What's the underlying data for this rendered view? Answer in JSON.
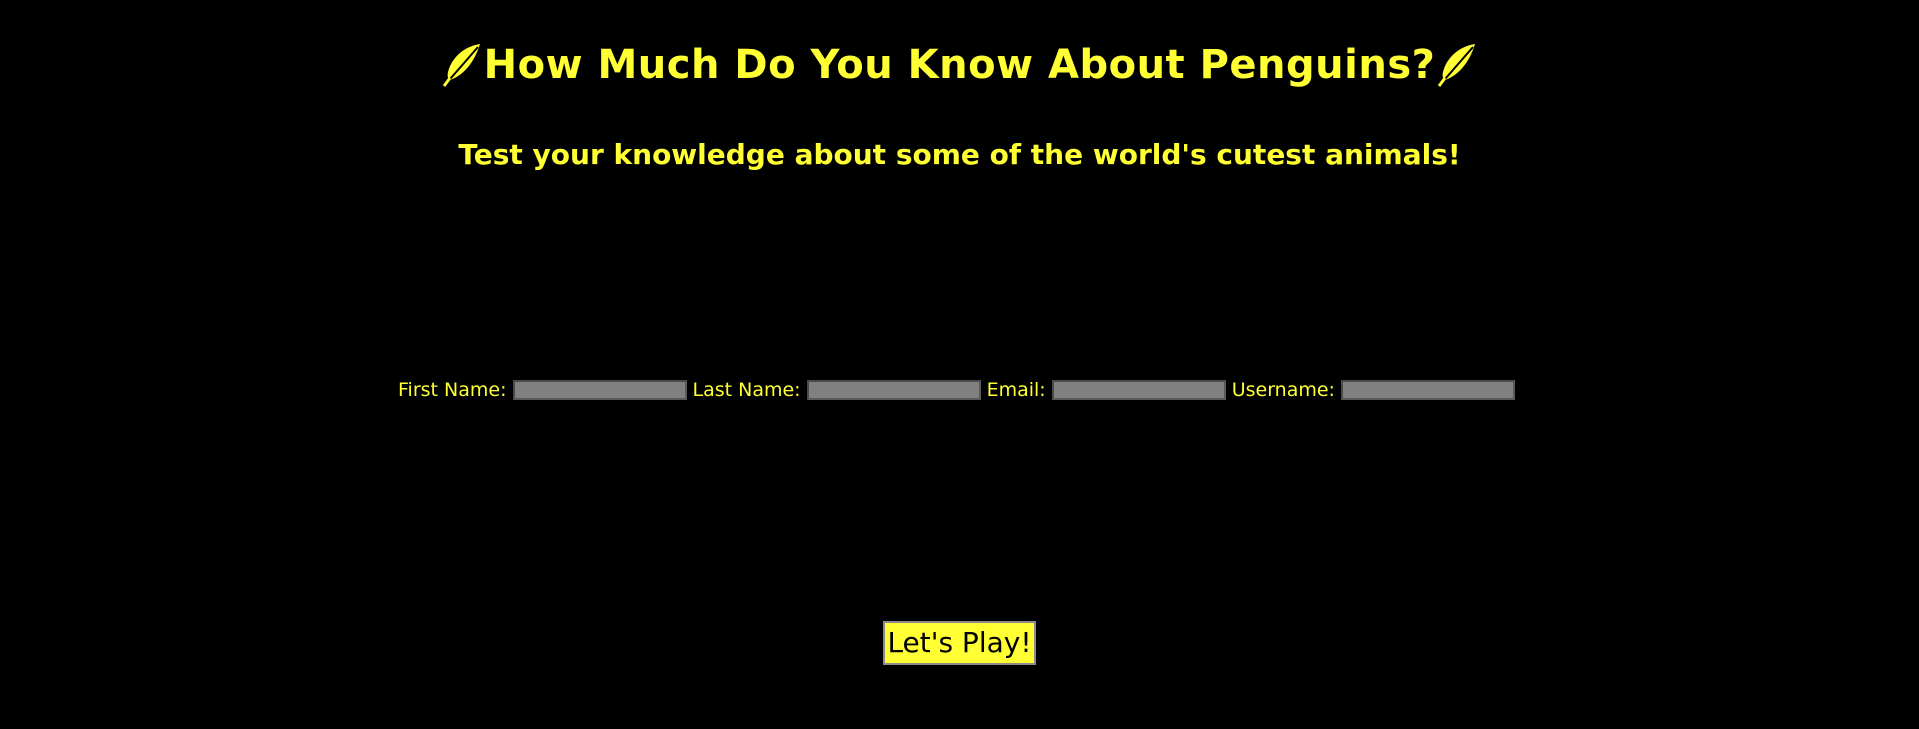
{
  "header": {
    "title": "How Much Do You Know About Penguins?",
    "left_icon": "feather-icon",
    "right_icon": "feather-icon",
    "subtitle": "Test your knowledge about some of the world's cutest animals!"
  },
  "form": {
    "first_name_label": "First Name:",
    "first_name_value": "",
    "last_name_label": "Last Name:",
    "last_name_value": "",
    "email_label": "Email:",
    "email_value": "",
    "username_label": "Username:",
    "username_value": ""
  },
  "actions": {
    "play_label": "Let's Play!"
  },
  "colors": {
    "background": "#000000",
    "accent": "#ffff33",
    "input_background": "#808080"
  }
}
